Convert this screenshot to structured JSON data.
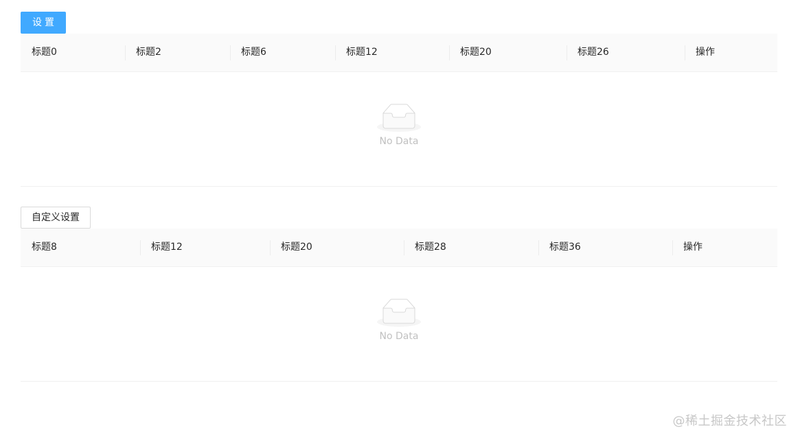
{
  "section1": {
    "button_label": "设置",
    "columns": [
      "标题0",
      "标题2",
      "标题6",
      "标题12",
      "标题20",
      "标题26",
      "操作"
    ],
    "empty_text": "No Data"
  },
  "section2": {
    "button_label": "自定义设置",
    "columns": [
      "标题8",
      "标题12",
      "标题20",
      "标题28",
      "标题36",
      "操作"
    ],
    "empty_text": "No Data"
  },
  "watermark": "@稀土掘金技术社区",
  "colors": {
    "primary": "#40a9ff",
    "header_bg": "#fafafa",
    "border": "#f0f0f0"
  }
}
